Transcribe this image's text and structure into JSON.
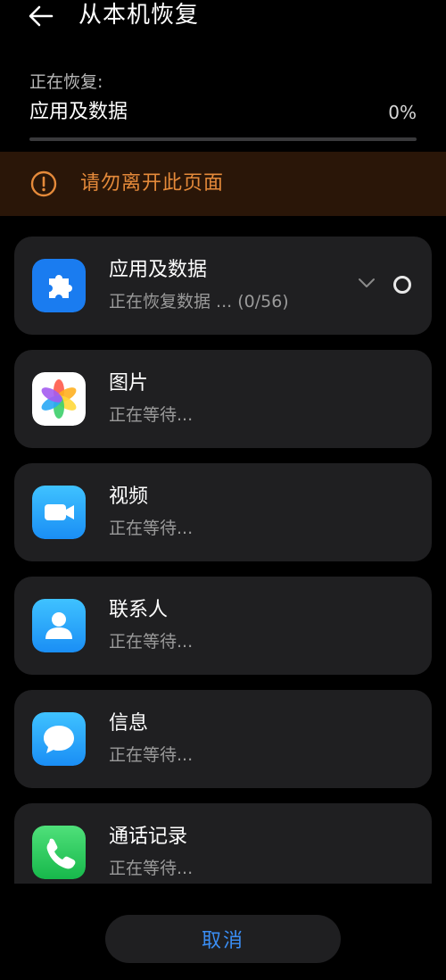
{
  "header": {
    "title": "从本机恢复",
    "back_icon": "back-arrow-icon"
  },
  "progress": {
    "label": "正在恢复:",
    "current_item": "应用及数据",
    "percent_text": "0%",
    "percent_value": 0
  },
  "warning": {
    "icon": "warning-circle-icon",
    "text": "请勿离开此页面",
    "color": "#e58a3a"
  },
  "items": [
    {
      "title": "应用及数据",
      "status": "正在恢复数据 ... (0/56)",
      "icon": "puzzle-icon",
      "expanded_indicator": "chevron-down-icon"
    },
    {
      "title": "图片",
      "status": "正在等待...",
      "icon": "gallery-flower-icon"
    },
    {
      "title": "视频",
      "status": "正在等待...",
      "icon": "video-camera-icon"
    },
    {
      "title": "联系人",
      "status": "正在等待...",
      "icon": "contact-person-icon"
    },
    {
      "title": "信息",
      "status": "正在等待...",
      "icon": "message-bubble-icon"
    },
    {
      "title": "通话记录",
      "status": "正在等待...",
      "icon": "phone-icon"
    }
  ],
  "footer": {
    "cancel_label": "取消",
    "accent": "#3a8ef5"
  }
}
